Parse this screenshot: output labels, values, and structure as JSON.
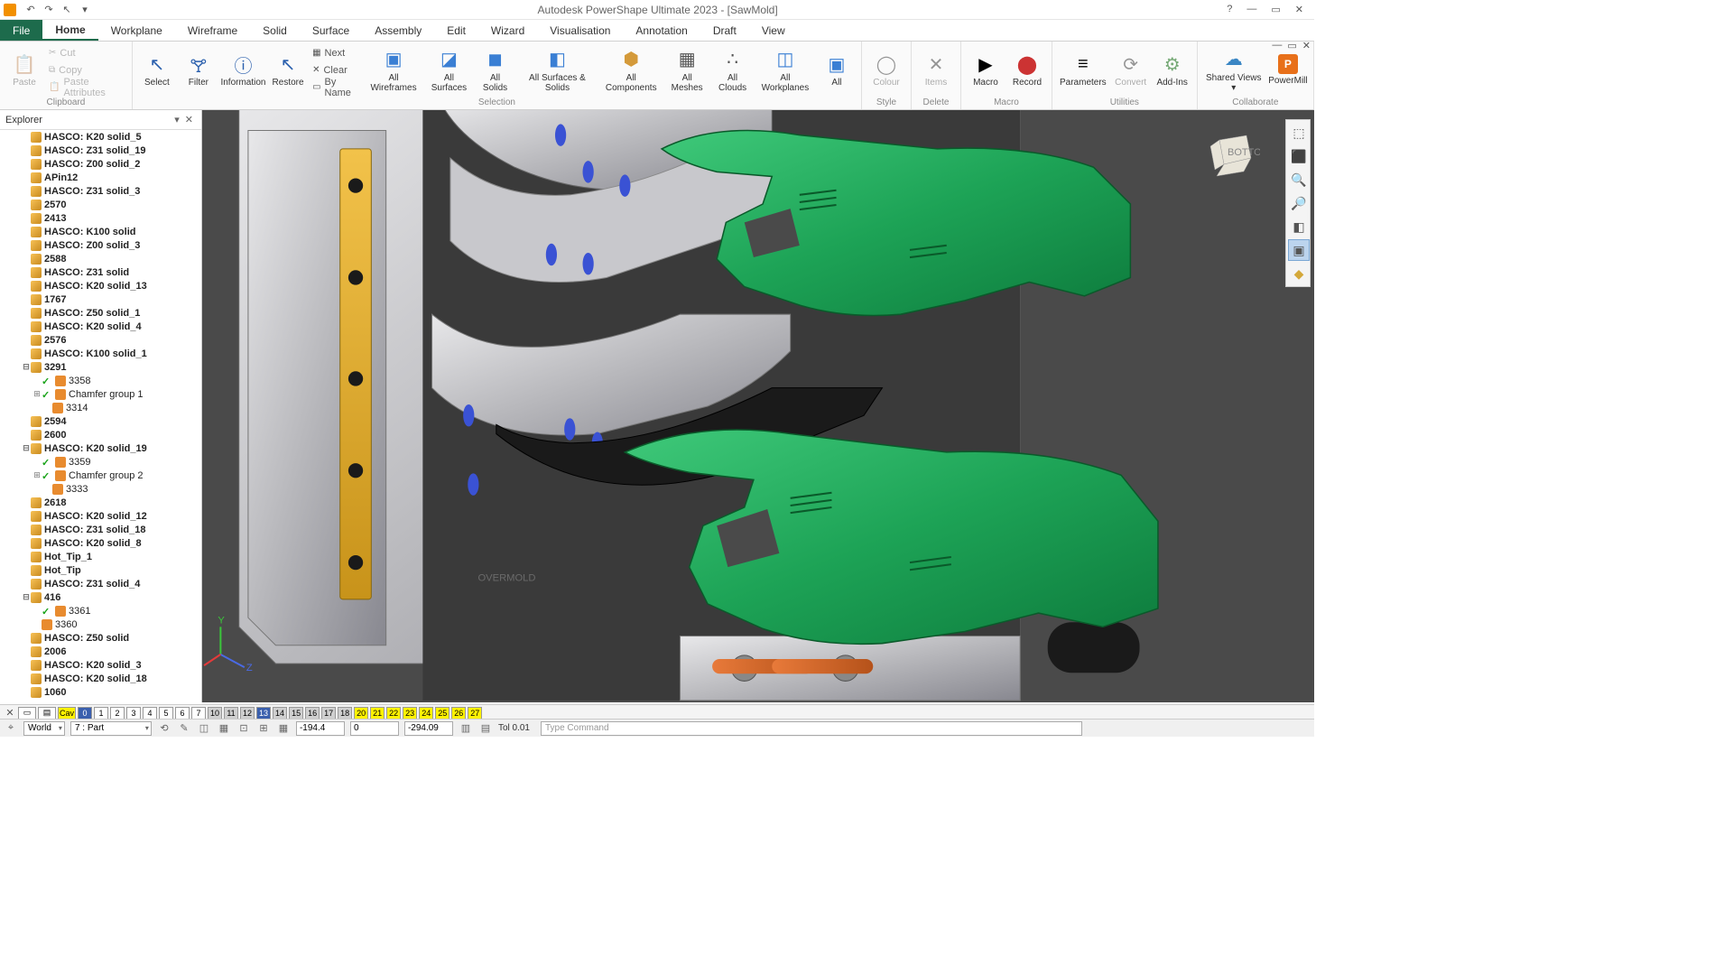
{
  "title": "Autodesk PowerShape Ultimate 2023 - [SawMold]",
  "menu": {
    "file": "File",
    "tabs": [
      "Home",
      "Workplane",
      "Wireframe",
      "Solid",
      "Surface",
      "Assembly",
      "Edit",
      "Wizard",
      "Visualisation",
      "Annotation",
      "Draft",
      "View"
    ],
    "active": "Home"
  },
  "ribbon": {
    "clipboard": {
      "label": "Clipboard",
      "paste": "Paste",
      "cut": "Cut",
      "copy": "Copy",
      "pasteattr": "Paste Attributes"
    },
    "selection": {
      "label": "Selection",
      "select": "Select",
      "filter": "Filter",
      "info": "Information",
      "restore": "Restore",
      "next": "Next",
      "clear": "Clear",
      "byname": "By Name",
      "wf": "All\nWireframes",
      "surf": "All\nSurfaces",
      "sol": "All\nSolids",
      "ss": "All Surfaces\n& Solids",
      "comp": "All\nComponents",
      "mesh": "All\nMeshes",
      "cloud": "All\nClouds",
      "wp": "All\nWorkplanes",
      "all": "All"
    },
    "style": {
      "label": "Style",
      "colour": "Colour"
    },
    "delete": {
      "label": "Delete",
      "items": "Items"
    },
    "macro": {
      "label": "Macro",
      "macro": "Macro",
      "record": "Record"
    },
    "util": {
      "label": "Utilities",
      "param": "Parameters",
      "convert": "Convert",
      "addins": "Add-Ins"
    },
    "collab": {
      "label": "Collaborate",
      "shared": "Shared\nViews ▾",
      "pm": "PowerMill"
    }
  },
  "explorer": {
    "title": "Explorer",
    "items": [
      {
        "d": 2,
        "t": "HASCO: K20 solid_5",
        "b": 1
      },
      {
        "d": 2,
        "t": "HASCO: Z31 solid_19",
        "b": 1
      },
      {
        "d": 2,
        "t": "HASCO: Z00 solid_2",
        "b": 1
      },
      {
        "d": 2,
        "t": "APin12",
        "b": 1
      },
      {
        "d": 2,
        "t": "HASCO: Z31 solid_3",
        "b": 1
      },
      {
        "d": 2,
        "t": "2570",
        "b": 1
      },
      {
        "d": 2,
        "t": "2413",
        "b": 1
      },
      {
        "d": 2,
        "t": "HASCO: K100 solid",
        "b": 1
      },
      {
        "d": 2,
        "t": "HASCO: Z00 solid_3",
        "b": 1
      },
      {
        "d": 2,
        "t": "2588",
        "b": 1
      },
      {
        "d": 2,
        "t": "HASCO: Z31 solid",
        "b": 1
      },
      {
        "d": 2,
        "t": "HASCO: K20 solid_13",
        "b": 1
      },
      {
        "d": 2,
        "t": "1767",
        "b": 1
      },
      {
        "d": 2,
        "t": "HASCO: Z50 solid_1",
        "b": 1
      },
      {
        "d": 2,
        "t": "HASCO: K20 solid_4",
        "b": 1
      },
      {
        "d": 2,
        "t": "2576",
        "b": 1
      },
      {
        "d": 2,
        "t": "HASCO: K100 solid_1",
        "b": 1
      },
      {
        "d": 2,
        "t": "3291",
        "b": 1,
        "tw": "⊟"
      },
      {
        "d": 3,
        "t": "3358",
        "ic": "chk",
        "suf": "feat"
      },
      {
        "d": 3,
        "t": "Chamfer group 1",
        "ic": "chk",
        "suf": "feat",
        "tw": "⊞"
      },
      {
        "d": 4,
        "t": "3314",
        "ic": "",
        "suf": "feat"
      },
      {
        "d": 2,
        "t": "2594",
        "b": 1
      },
      {
        "d": 2,
        "t": "2600",
        "b": 1
      },
      {
        "d": 2,
        "t": "HASCO: K20 solid_19",
        "b": 1,
        "tw": "⊟"
      },
      {
        "d": 3,
        "t": "3359",
        "ic": "chk",
        "suf": "feat"
      },
      {
        "d": 3,
        "t": "Chamfer group 2",
        "ic": "chk",
        "suf": "feat",
        "tw": "⊞"
      },
      {
        "d": 4,
        "t": "3333",
        "ic": "",
        "suf": "feat"
      },
      {
        "d": 2,
        "t": "2618",
        "b": 1
      },
      {
        "d": 2,
        "t": "HASCO: K20 solid_12",
        "b": 1
      },
      {
        "d": 2,
        "t": "HASCO: Z31 solid_18",
        "b": 1
      },
      {
        "d": 2,
        "t": "HASCO: K20 solid_8",
        "b": 1
      },
      {
        "d": 2,
        "t": "Hot_Tip_1",
        "b": 1
      },
      {
        "d": 2,
        "t": "Hot_Tip",
        "b": 1
      },
      {
        "d": 2,
        "t": "HASCO: Z31 solid_4",
        "b": 1
      },
      {
        "d": 2,
        "t": "416",
        "b": 1,
        "tw": "⊟"
      },
      {
        "d": 3,
        "t": "3361",
        "ic": "chk",
        "suf": "feat"
      },
      {
        "d": 3,
        "t": "3360",
        "ic": "",
        "suf": "feat"
      },
      {
        "d": 2,
        "t": "HASCO: Z50 solid",
        "b": 1
      },
      {
        "d": 2,
        "t": "2006",
        "b": 1
      },
      {
        "d": 2,
        "t": "HASCO: K20 solid_3",
        "b": 1
      },
      {
        "d": 2,
        "t": "HASCO: K20 solid_18",
        "b": 1
      },
      {
        "d": 2,
        "t": "1060",
        "b": 1
      }
    ]
  },
  "layers": {
    "cav": "Cav",
    "nums": [
      {
        "n": "0",
        "c": "b"
      },
      {
        "n": "1"
      },
      {
        "n": "2"
      },
      {
        "n": "3"
      },
      {
        "n": "4"
      },
      {
        "n": "5"
      },
      {
        "n": "6"
      },
      {
        "n": "7"
      },
      {
        "n": "10",
        "c": "g"
      },
      {
        "n": "11",
        "c": "g"
      },
      {
        "n": "12",
        "c": "g"
      },
      {
        "n": "13",
        "c": "b"
      },
      {
        "n": "14",
        "c": "g"
      },
      {
        "n": "15",
        "c": "g"
      },
      {
        "n": "16",
        "c": "g"
      },
      {
        "n": "17",
        "c": "g"
      },
      {
        "n": "18",
        "c": "g"
      },
      {
        "n": "20",
        "c": "y"
      },
      {
        "n": "21",
        "c": "y"
      },
      {
        "n": "22",
        "c": "y"
      },
      {
        "n": "23",
        "c": "y"
      },
      {
        "n": "24",
        "c": "y"
      },
      {
        "n": "25",
        "c": "y"
      },
      {
        "n": "26",
        "c": "y"
      },
      {
        "n": "27",
        "c": "y"
      }
    ]
  },
  "status": {
    "world": "World",
    "part": "7  : Part",
    "x": "-194.4",
    "y": "0",
    "z": "-294.09",
    "tol": "Tol  0.01",
    "cmd": "Type Command"
  },
  "viewport": {
    "labels": {
      "overmold": "OVERMOLD",
      "bottom": "BOTTOM"
    },
    "axes": {
      "y": "Y",
      "z": "Z"
    }
  }
}
